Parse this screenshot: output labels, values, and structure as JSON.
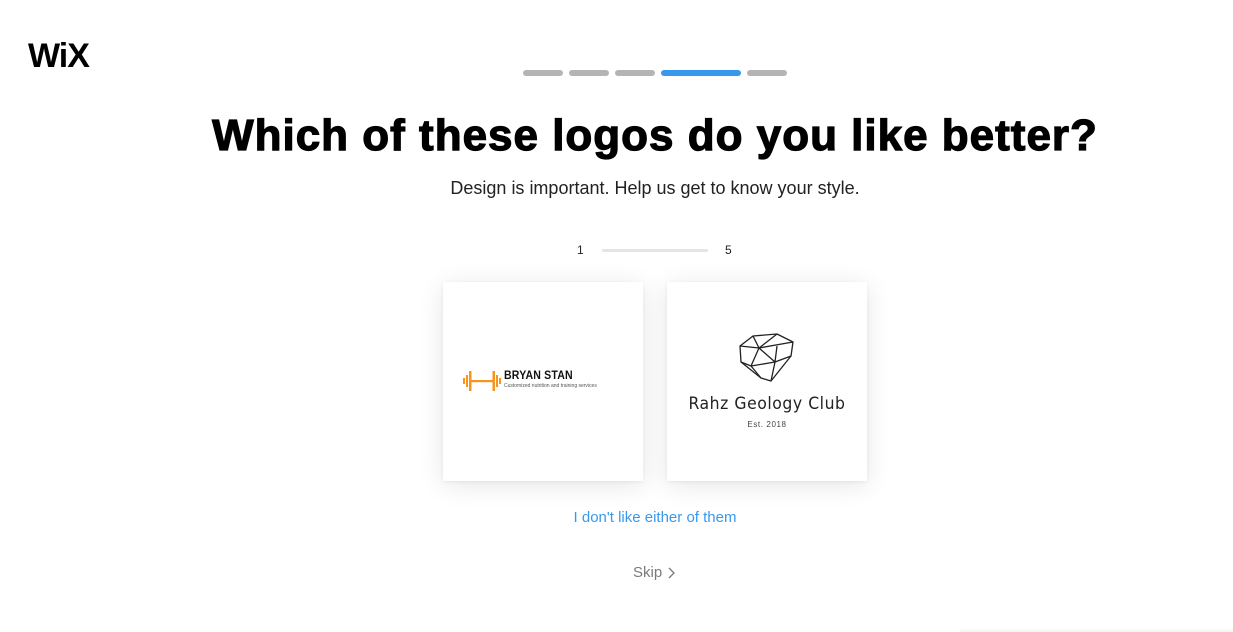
{
  "brand": {
    "logo_text": "WiX"
  },
  "stepper": {
    "steps": 5,
    "active_step": 4
  },
  "heading": {
    "title": "Which of these logos do you like better?",
    "subtitle": "Design is important. Help us get to know your style."
  },
  "progress": {
    "start": "1",
    "end": "5"
  },
  "options": [
    {
      "name": "BRYAN STAN",
      "tagline": "Customized nutrition and training services",
      "icon": "dumbbell-icon",
      "accent": "#f7941d"
    },
    {
      "name": "Rahz Geology Club",
      "tagline": "Est. 2018",
      "icon": "gem-icon"
    }
  ],
  "actions": {
    "neither_label": "I don't like either of them",
    "skip_label": "Skip"
  },
  "colors": {
    "accent": "#3899ec",
    "inactive_step": "#b4b4b4"
  }
}
